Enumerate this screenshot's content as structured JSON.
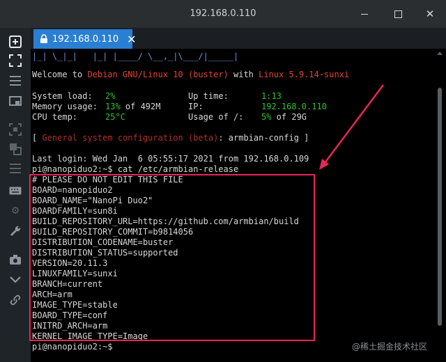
{
  "window": {
    "title": "192.168.0.110"
  },
  "tab": {
    "label": "192.168.0.110"
  },
  "sidebar": {
    "icons": [
      "plus-box-icon",
      "expand-icon",
      "menu-icon",
      "folder-icon",
      "selection-icon",
      "layers-icon",
      "list-icon",
      "keyboard-icon",
      "gears-icon",
      "wrench-icon",
      "camera-icon",
      "chevron-down-icon",
      "link-icon"
    ]
  },
  "terminal": {
    "banner_tail": "|_| \\_|_|   |_| |____/ \\__,_|\\___/|_____|",
    "welcome": {
      "prefix": "Welcome to ",
      "os": "Debian GNU/Linux 10 (buster)",
      "with": " with ",
      "kernel": "Linux 5.9.14-sunxi"
    },
    "stats": {
      "system_load_label": "System load:",
      "system_load_value": "2%",
      "uptime_label": "Up time:",
      "uptime_value": "1:13",
      "memory_label": "Memory usage:",
      "memory_value": "13%",
      "memory_of": " of 492M",
      "ip_label": "IP:",
      "ip_value": "192.168.0.110",
      "cpu_label": "CPU temp:",
      "cpu_value": "25°C",
      "usage_label": "Usage of /:",
      "usage_value": "5%",
      "usage_of": " of 29G"
    },
    "config_hint": {
      "open": "[ ",
      "text": "General system configuration (beta)",
      "rest": ": armbian-config ]"
    },
    "last_login": "Last login: Wed Jan  6 05:55:17 2021 from 192.168.0.109",
    "command": "pi@nanopiduo2:~$ cat /etc/armbian-release",
    "release_lines": [
      "# PLEASE DO NOT EDIT THIS FILE",
      "BOARD=nanopiduo2",
      "BOARD_NAME=\"NanoPi Duo2\"",
      "BOARDFAMILY=sun8i",
      "BUILD_REPOSITORY_URL=https://github.com/armbian/build",
      "BUILD_REPOSITORY_COMMIT=b9814056",
      "DISTRIBUTION_CODENAME=buster",
      "DISTRIBUTION_STATUS=supported",
      "VERSION=20.11.3",
      "LINUXFAMILY=sunxi",
      "BRANCH=current",
      "ARCH=arm",
      "IMAGE_TYPE=stable",
      "BOARD_TYPE=conf",
      "INITRD_ARCH=arm",
      "KERNEL_IMAGE_TYPE=Image"
    ],
    "prompt": "pi@nanopiduo2:~$"
  },
  "watermark": "@稀土掘金技术社区",
  "colors": {
    "tab_accent": "#2a7fd2",
    "highlight_border": "#e8265a",
    "term_red": "#e0433b",
    "term_green": "#2ec22e"
  }
}
